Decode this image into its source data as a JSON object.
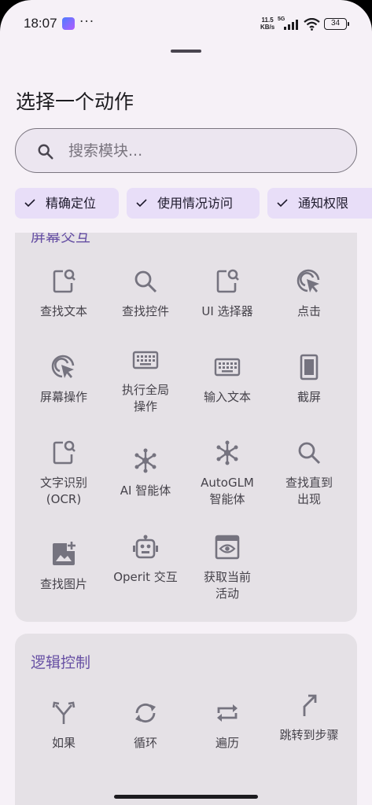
{
  "status_bar": {
    "time": "18:07",
    "more": "···",
    "net_speed": "11.5",
    "net_unit": "KB/s",
    "network": "5G",
    "battery": "34"
  },
  "sheet": {
    "title": "选择一个动作",
    "search": {
      "placeholder": "搜索模块..."
    },
    "chips": [
      {
        "label": "精确定位",
        "checked": true
      },
      {
        "label": "使用情况访问",
        "checked": true
      },
      {
        "label": "通知权限",
        "checked": true
      }
    ]
  },
  "screen_interaction": {
    "title": "屏幕交互",
    "items": [
      {
        "label": "查找文本",
        "icon": "search-text-icon"
      },
      {
        "label": "查找控件",
        "icon": "search-icon"
      },
      {
        "label": "UI 选择器",
        "icon": "search-text-icon"
      },
      {
        "label": "点击",
        "icon": "tap-icon"
      },
      {
        "label": "屏幕操作",
        "icon": "tap-icon"
      },
      {
        "label": "执行全局操作",
        "icon": "keyboard-icon"
      },
      {
        "label": "输入文本",
        "icon": "keyboard-icon"
      },
      {
        "label": "截屏",
        "icon": "phone-screen-icon"
      },
      {
        "label": "文字识别 (OCR)",
        "icon": "search-text-icon"
      },
      {
        "label": "AI 智能体",
        "icon": "hub-icon"
      },
      {
        "label": "AutoGLM 智能体",
        "icon": "hub-icon"
      },
      {
        "label": "查找直到出现",
        "icon": "search-icon"
      },
      {
        "label": "查找图片",
        "icon": "image-plus-icon"
      },
      {
        "label": "Operit 交互",
        "icon": "robot-icon"
      },
      {
        "label": "获取当前活动",
        "icon": "preview-window-icon"
      }
    ]
  },
  "logic_control": {
    "title": "逻辑控制",
    "items": [
      {
        "label": "如果",
        "icon": "branch-icon"
      },
      {
        "label": "循环",
        "icon": "loop-icon"
      },
      {
        "label": "遍历",
        "icon": "repeat-icon"
      },
      {
        "label": "跳转到步骤",
        "icon": "jump-arrow-icon"
      }
    ]
  },
  "colors": {
    "accent": "#6750a4",
    "icon": "#75737f",
    "card": "#e5e1e6",
    "chip": "#e8def8",
    "sheet": "#f6f1f7"
  }
}
